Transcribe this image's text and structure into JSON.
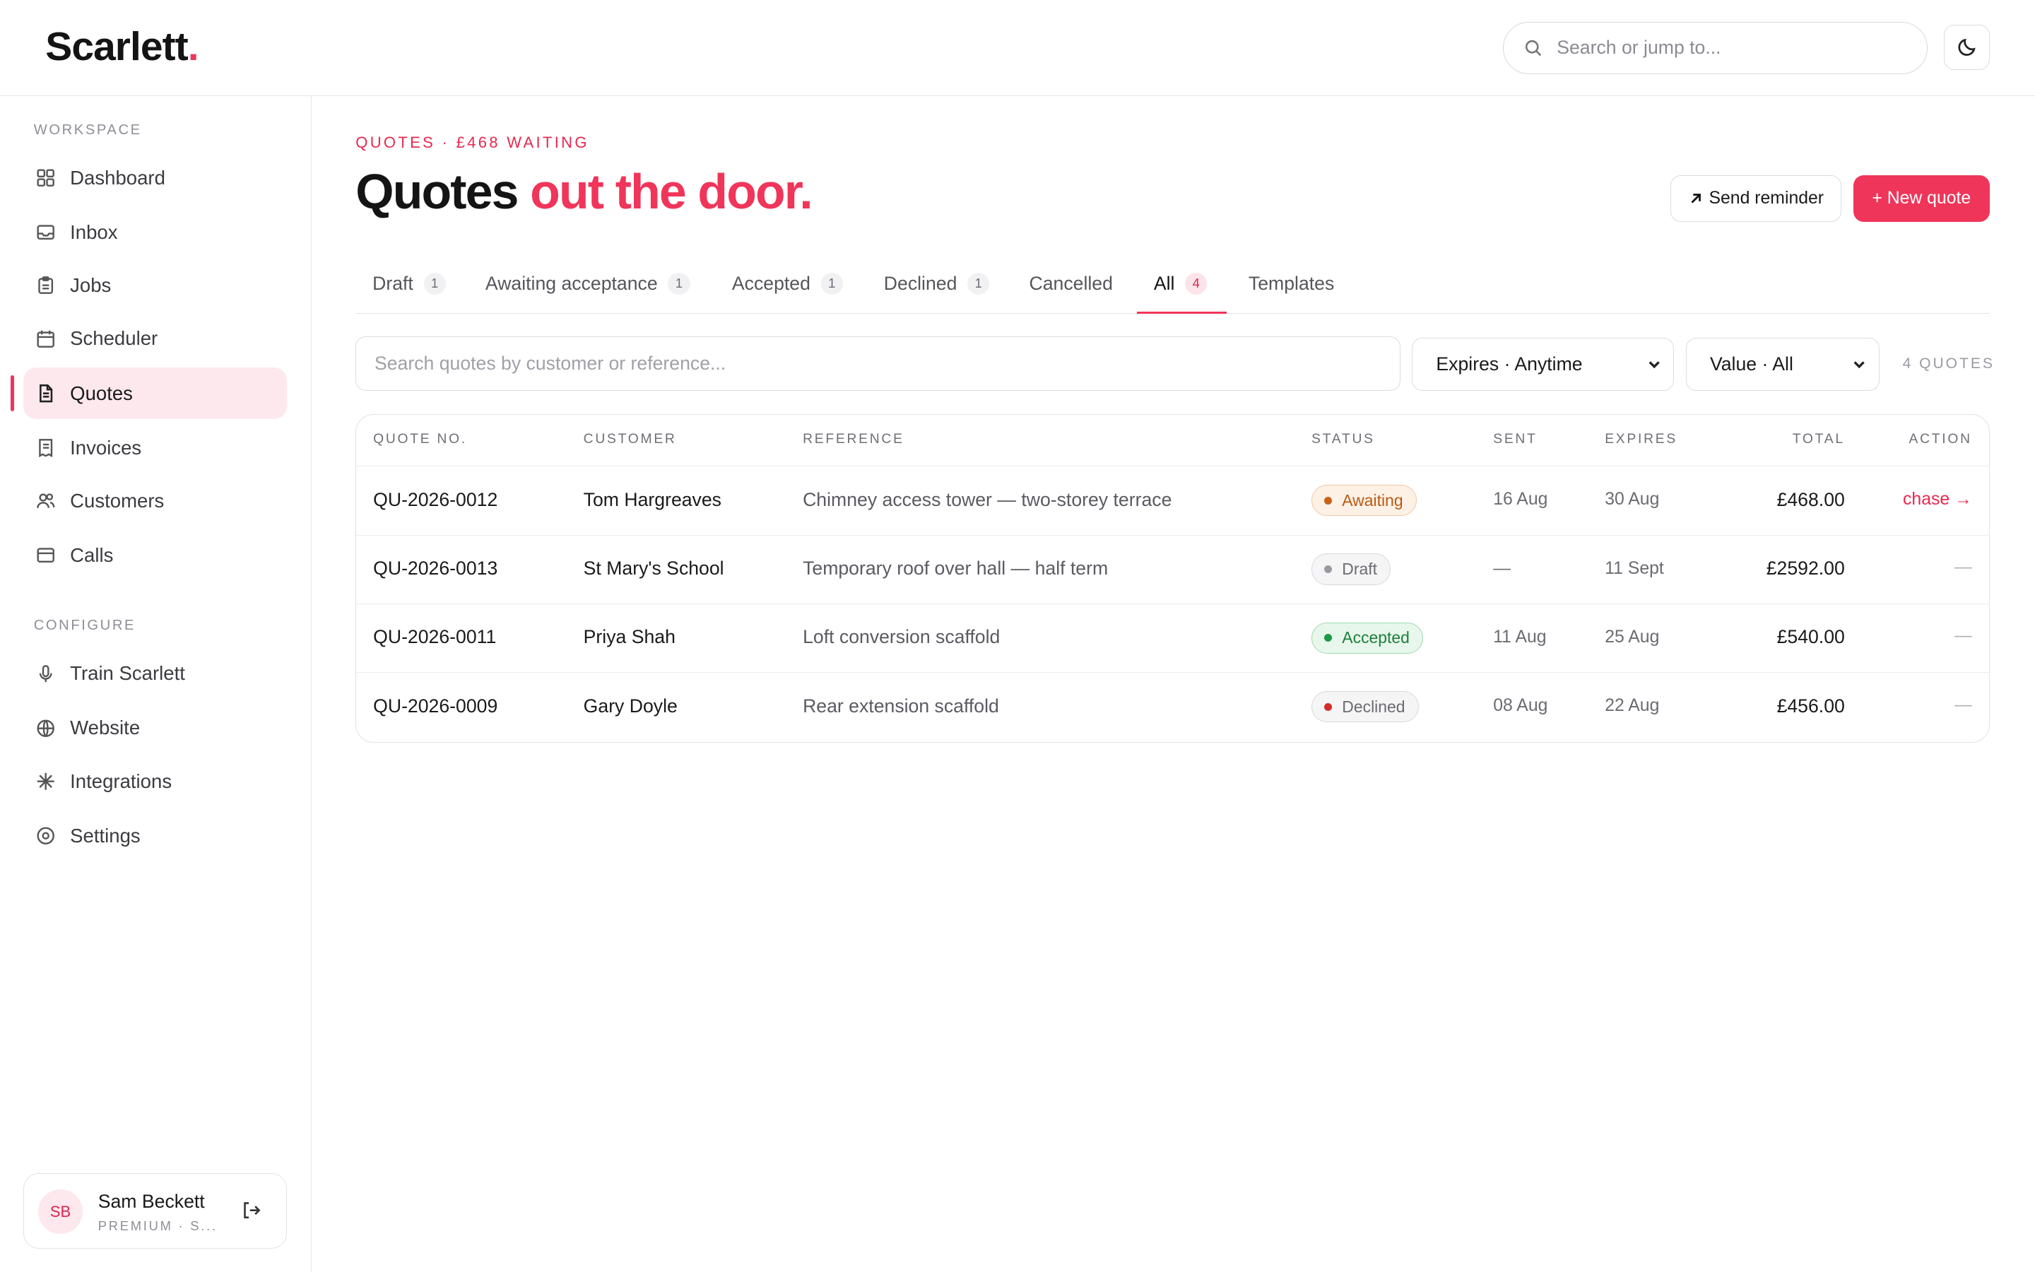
{
  "app": {
    "logo_text": "Scarlett",
    "logo_dot": "."
  },
  "header": {
    "search_placeholder": "Search or jump to..."
  },
  "sidebar": {
    "workspace_title": "WORKSPACE",
    "workspace_items": [
      {
        "label": "Dashboard",
        "icon": "grid-icon"
      },
      {
        "label": "Inbox",
        "icon": "inbox-icon"
      },
      {
        "label": "Jobs",
        "icon": "clipboard-icon"
      },
      {
        "label": "Scheduler",
        "icon": "calendar-icon"
      },
      {
        "label": "Quotes",
        "icon": "document-icon",
        "active": true
      },
      {
        "label": "Invoices",
        "icon": "receipt-icon"
      },
      {
        "label": "Customers",
        "icon": "users-icon"
      },
      {
        "label": "Calls",
        "icon": "phone-icon"
      }
    ],
    "configure_title": "CONFIGURE",
    "configure_items": [
      {
        "label": "Train Scarlett",
        "icon": "microphone-icon"
      },
      {
        "label": "Website",
        "icon": "globe-icon"
      },
      {
        "label": "Integrations",
        "icon": "sparkle-icon"
      },
      {
        "label": "Settings",
        "icon": "settings-icon"
      }
    ],
    "user": {
      "initials": "SB",
      "name": "Sam Beckett",
      "plan": "PREMIUM · S..."
    }
  },
  "main": {
    "eyebrow": "QUOTES · £468 WAITING",
    "title_main": "Quotes ",
    "title_accent": "out the door.",
    "send_reminder_label": "Send reminder",
    "new_quote_label": "+ New quote",
    "tabs": [
      {
        "label": "Draft",
        "count": "1"
      },
      {
        "label": "Awaiting acceptance",
        "count": "1"
      },
      {
        "label": "Accepted",
        "count": "1"
      },
      {
        "label": "Declined",
        "count": "1"
      },
      {
        "label": "Cancelled",
        "count": ""
      },
      {
        "label": "All",
        "count": "4",
        "active": true
      },
      {
        "label": "Templates",
        "count": ""
      }
    ],
    "search_placeholder": "Search quotes by customer or reference...",
    "filter_expires": "Expires · Anytime",
    "filter_value": "Value · All",
    "quotes_count": "4 QUOTES",
    "table": {
      "headers": [
        "QUOTE NO.",
        "CUSTOMER",
        "REFERENCE",
        "STATUS",
        "SENT",
        "EXPIRES",
        "TOTAL",
        "ACTION"
      ],
      "rows": [
        {
          "quote_no": "QU-2026-0012",
          "customer": "Tom Hargreaves",
          "reference": "Chimney access tower — two-storey terrace",
          "status": "Awaiting",
          "sent": "16 Aug",
          "expires": "30 Aug",
          "total": "£468.00",
          "action": "chase →"
        },
        {
          "quote_no": "QU-2026-0013",
          "customer": "St Mary's School",
          "reference": "Temporary roof over hall — half term",
          "status": "Draft",
          "sent": "—",
          "expires": "11 Sept",
          "total": "£2592.00",
          "action": "—"
        },
        {
          "quote_no": "QU-2026-0011",
          "customer": "Priya Shah",
          "reference": "Loft conversion scaffold",
          "status": "Accepted",
          "sent": "11 Aug",
          "expires": "25 Aug",
          "total": "£540.00",
          "action": "—"
        },
        {
          "quote_no": "QU-2026-0009",
          "customer": "Gary Doyle",
          "reference": "Rear extension scaffold",
          "status": "Declined",
          "sent": "08 Aug",
          "expires": "22 Aug",
          "total": "£456.00",
          "action": "—"
        }
      ]
    }
  },
  "colors": {
    "accent": "#f0355a",
    "awaiting": "#c8631a",
    "accepted": "#1c9a47",
    "declined": "#d62b2b"
  }
}
